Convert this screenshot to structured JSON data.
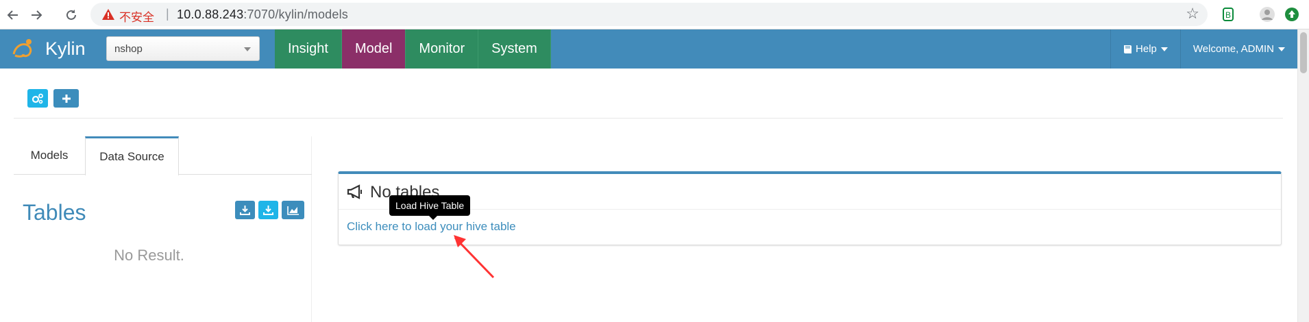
{
  "browser": {
    "insecure_label": "不安全",
    "separator": "|",
    "url_host": "10.0.88.243",
    "url_rest": ":7070/kylin/models"
  },
  "header": {
    "brand": "Kylin",
    "project": "nshop",
    "nav": [
      "Insight",
      "Model",
      "Monitor",
      "System"
    ],
    "active_nav": "Model",
    "help_label": "Help",
    "welcome_label": "Welcome, ADMIN"
  },
  "left_panel": {
    "tabs": [
      "Models",
      "Data Source"
    ],
    "active_tab": "Data Source",
    "tables_title": "Tables",
    "no_result": "No Result."
  },
  "main_box": {
    "title": "No tables",
    "link": "Click here to load your hive table"
  },
  "tooltip": {
    "text": "Load Hive Table"
  },
  "colors": {
    "navbar": "#428bba",
    "nav_green": "#2e8c60",
    "nav_active": "#8b2f68",
    "button_cyan": "#1fb5e8",
    "button_blue": "#3c8dbc",
    "annotation_red": "#ff3333"
  },
  "icons": [
    "back-icon",
    "forward-icon",
    "reload-icon",
    "warning-icon",
    "star-icon",
    "extension-icon",
    "profile-icon",
    "update-icon",
    "cogs-icon",
    "plus-icon",
    "download-icon",
    "chart-icon",
    "megaphone-icon",
    "book-icon"
  ]
}
